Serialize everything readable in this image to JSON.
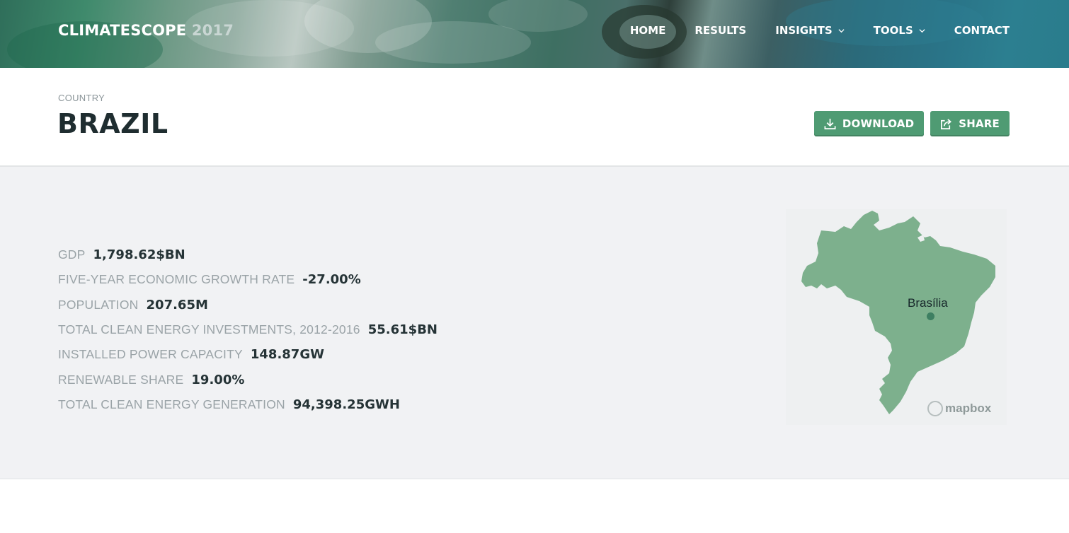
{
  "header": {
    "brand_name": "CLIMATESCOPE",
    "brand_year": "2017",
    "nav": [
      {
        "label": "HOME",
        "has_dropdown": false
      },
      {
        "label": "RESULTS",
        "has_dropdown": false
      },
      {
        "label": "INSIGHTS",
        "has_dropdown": true
      },
      {
        "label": "TOOLS",
        "has_dropdown": true
      },
      {
        "label": "CONTACT",
        "has_dropdown": false
      }
    ]
  },
  "page": {
    "eyebrow": "COUNTRY",
    "title": "BRAZIL",
    "download_label": "DOWNLOAD",
    "share_label": "SHARE"
  },
  "stats": [
    {
      "label": "GDP",
      "value": "1,798.62$BN"
    },
    {
      "label": "FIVE-YEAR ECONOMIC GROWTH RATE",
      "value": "-27.00%"
    },
    {
      "label": "POPULATION",
      "value": "207.65M"
    },
    {
      "label": "TOTAL CLEAN ENERGY INVESTMENTS, 2012-2016",
      "value": "55.61$BN"
    },
    {
      "label": "INSTALLED POWER CAPACITY",
      "value": "148.87GW"
    },
    {
      "label": "RENEWABLE SHARE",
      "value": "19.00%"
    },
    {
      "label": "TOTAL CLEAN ENERGY GENERATION",
      "value": "94,398.25GWH"
    }
  ],
  "map": {
    "city_label": "Brasília",
    "attribution": "mapbox",
    "country_fill": "#7db08d"
  },
  "colors": {
    "accent": "#4f9b73",
    "panel_bg": "#f1f2f4"
  },
  "icons": {
    "download": "download-icon",
    "share": "share-icon",
    "dropdown": "chevron-down-icon"
  }
}
